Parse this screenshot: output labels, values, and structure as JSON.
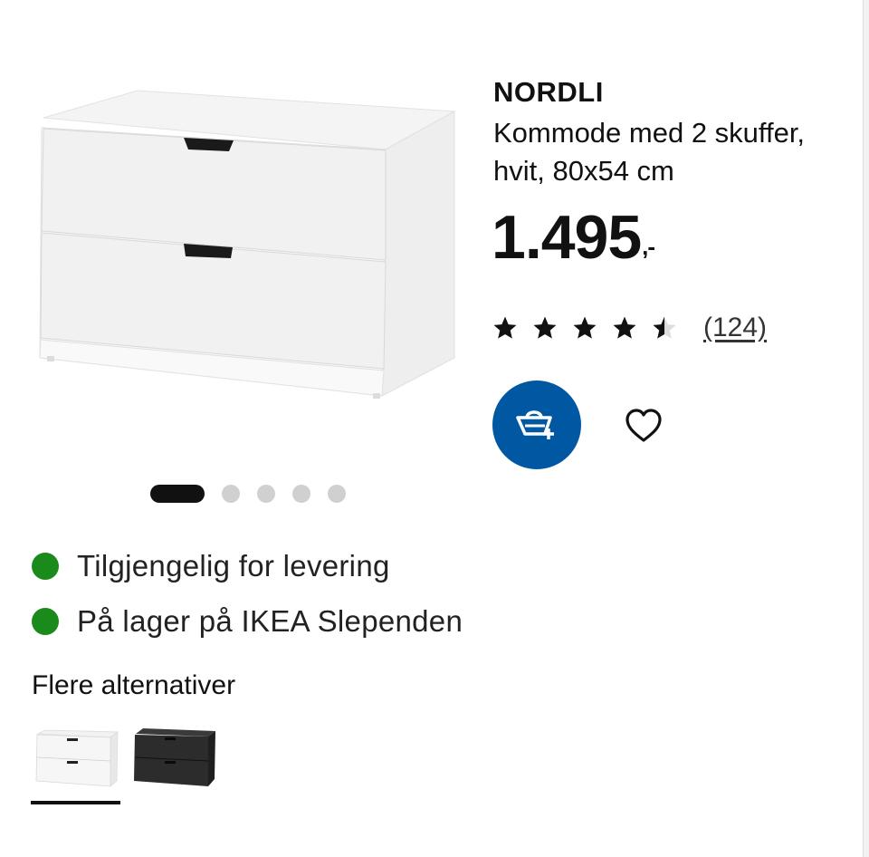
{
  "product": {
    "name": "NORDLI",
    "description": "Kommode med 2 skuffer, hvit, 80x54 cm",
    "price": "1.495",
    "price_suffix": ",-",
    "rating": {
      "value": 4.5,
      "max": 5,
      "review_count_label": "(124)"
    }
  },
  "actions": {
    "cart_icon": "shopping-basket-add-icon",
    "favourite_icon": "heart-outline-icon"
  },
  "carousel": {
    "total": 5,
    "active_index": 0
  },
  "availability": [
    {
      "text": "Tilgjengelig for levering",
      "status_color": "#1a8a1a"
    },
    {
      "text": "På lager på IKEA Slependen",
      "status_color": "#1a8a1a"
    }
  ],
  "alternatives": {
    "heading": "Flere alternativer",
    "variants": [
      {
        "color_name": "hvit",
        "swatch": "#ffffff",
        "selected": true
      },
      {
        "color_name": "antrasitt",
        "swatch": "#2e2e2e",
        "selected": false
      }
    ]
  },
  "colors": {
    "brand_blue": "#0058a3",
    "in_stock_green": "#1a8a1a"
  }
}
